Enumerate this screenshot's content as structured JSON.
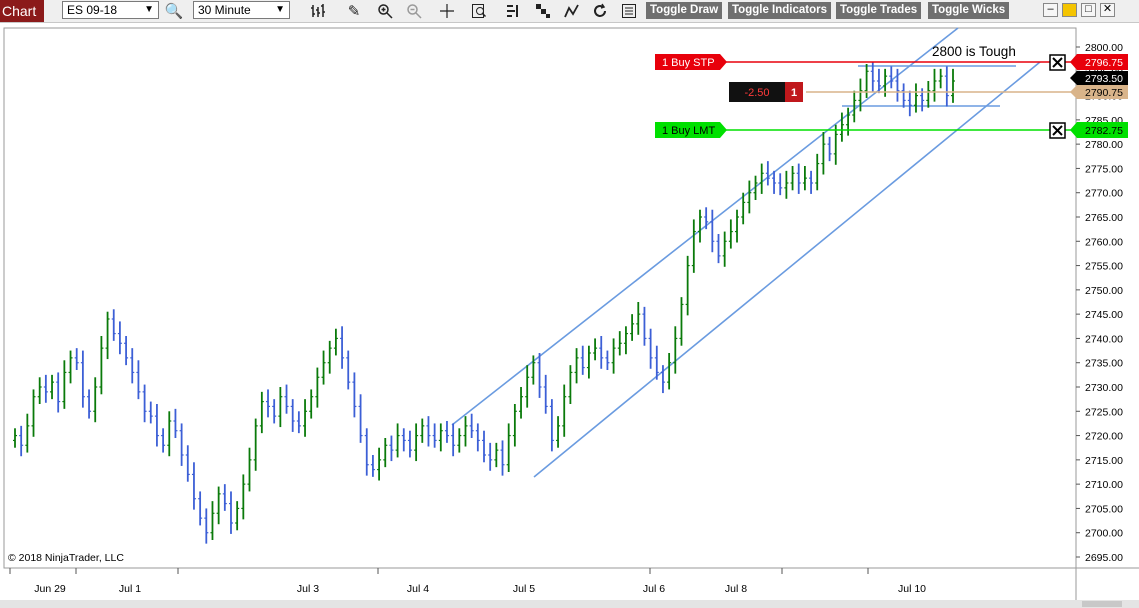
{
  "window": {
    "title": "Chart"
  },
  "toolbar": {
    "instrument": "ES 09-18",
    "interval": "30 Minute",
    "icons": [
      "search-icon",
      "bar-style-icon",
      "pencil-icon",
      "zoom-in-icon",
      "zoom-out-icon",
      "crosshair-icon",
      "data-box-icon",
      "order-flow-icon",
      "chart-trader-icon",
      "strategy-icon",
      "reload-icon",
      "properties-icon"
    ],
    "toggle_draw": "Toggle Draw",
    "toggle_indicators": "Toggle Indicators",
    "toggle_trades": "Toggle Trades",
    "toggle_wicks": "Toggle Wicks"
  },
  "chart": {
    "annotation": "2800 is Tough",
    "copyright": "© 2018 NinjaTrader, LLC",
    "orders": {
      "buy_stp": {
        "label": "1  Buy STP",
        "price": "2796.75",
        "color": "#e8000b"
      },
      "buy_lmt": {
        "label": "1  Buy LMT",
        "price": "2782.75",
        "color": "#00e000"
      },
      "position": {
        "pnl": "-2.50",
        "qty": "1",
        "price": "2790.75",
        "color": "#d9b48a"
      },
      "last_price": "2793.50"
    },
    "colors": {
      "up_bar": "#0a7a0a",
      "down_bar": "#3c5fd6",
      "trendline": "#6a9be0"
    }
  },
  "chart_data": {
    "type": "ohlc",
    "instrument": "ES 09-18",
    "interval": "30 Minute",
    "ylim": [
      2693,
      2803
    ],
    "y_ticks": [
      2695,
      2700,
      2705,
      2710,
      2715,
      2720,
      2725,
      2730,
      2735,
      2740,
      2745,
      2750,
      2755,
      2760,
      2765,
      2770,
      2775,
      2780,
      2785,
      2790,
      2795,
      2800
    ],
    "x_ticks": [
      "Jun 29",
      "Jul 1",
      "Jul 3",
      "Jul 4",
      "Jul 5",
      "Jul 6",
      "Jul 8",
      "Jul 10"
    ],
    "closes": [
      2720,
      2718,
      2722,
      2728,
      2730,
      2729,
      2731,
      2727,
      2733,
      2736,
      2735,
      2728,
      2725,
      2730,
      2738,
      2744,
      2741,
      2739,
      2736,
      2733,
      2729,
      2725,
      2724,
      2720,
      2718,
      2723,
      2721,
      2716,
      2712,
      2707,
      2703,
      2700,
      2704,
      2708,
      2706,
      2702,
      2705,
      2710,
      2715,
      2722,
      2727,
      2726,
      2724,
      2728,
      2726,
      2723,
      2722,
      2725,
      2728,
      2732,
      2735,
      2738,
      2740,
      2736,
      2731,
      2726,
      2720,
      2714,
      2713,
      2715,
      2718,
      2717,
      2720,
      2719,
      2717,
      2720,
      2722,
      2720,
      2719,
      2721,
      2720,
      2718,
      2720,
      2722,
      2721,
      2719,
      2716,
      2715,
      2717,
      2714,
      2720,
      2725,
      2728,
      2732,
      2735,
      2730,
      2726,
      2719,
      2722,
      2728,
      2733,
      2736,
      2734,
      2737,
      2738,
      2736,
      2735,
      2738,
      2739,
      2741,
      2743,
      2745,
      2740,
      2736,
      2733,
      2731,
      2735,
      2740,
      2747,
      2755,
      2762,
      2765,
      2764,
      2760,
      2757,
      2760,
      2762,
      2765,
      2768,
      2770,
      2772,
      2774,
      2773,
      2772,
      2771,
      2772,
      2774,
      2772,
      2773,
      2772,
      2776,
      2780,
      2778,
      2782,
      2784,
      2786,
      2789,
      2791,
      2795,
      2793,
      2792,
      2794,
      2793,
      2791,
      2789,
      2788,
      2790,
      2789,
      2791,
      2793,
      2794,
      2790,
      2793
    ]
  }
}
